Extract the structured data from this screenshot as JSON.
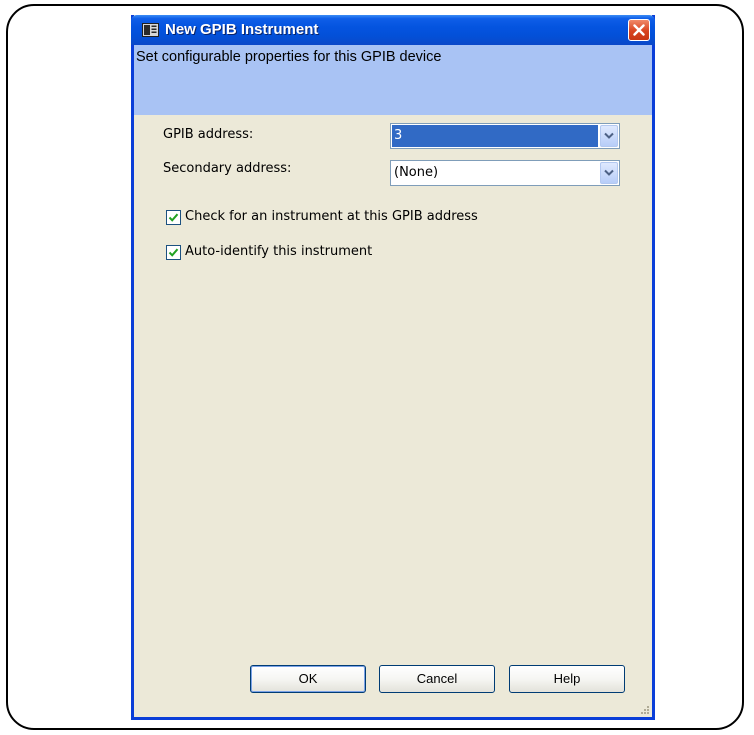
{
  "window": {
    "title": "New GPIB Instrument",
    "icon": "instrument-icon",
    "close_icon": "close-icon"
  },
  "header": {
    "text": "Set configurable properties for this GPIB device"
  },
  "fields": {
    "gpib_address_label": "GPIB address:",
    "gpib_address_value": "3",
    "secondary_address_label": "Secondary address:",
    "secondary_address_value": "(None)"
  },
  "checkboxes": {
    "check_instrument_label": "Check for an instrument at this GPIB address",
    "check_instrument_checked": true,
    "auto_identify_label": "Auto-identify this instrument",
    "auto_identify_checked": true
  },
  "buttons": {
    "ok_label": "OK",
    "cancel_label": "Cancel",
    "help_label": "Help"
  },
  "colors": {
    "titlebar": "#0454e0",
    "header_band": "#a9c3f4",
    "dialog_background": "#ece9d8",
    "selection": "#316ac5",
    "close_button": "#d8431f",
    "checkmark": "#21a121"
  }
}
